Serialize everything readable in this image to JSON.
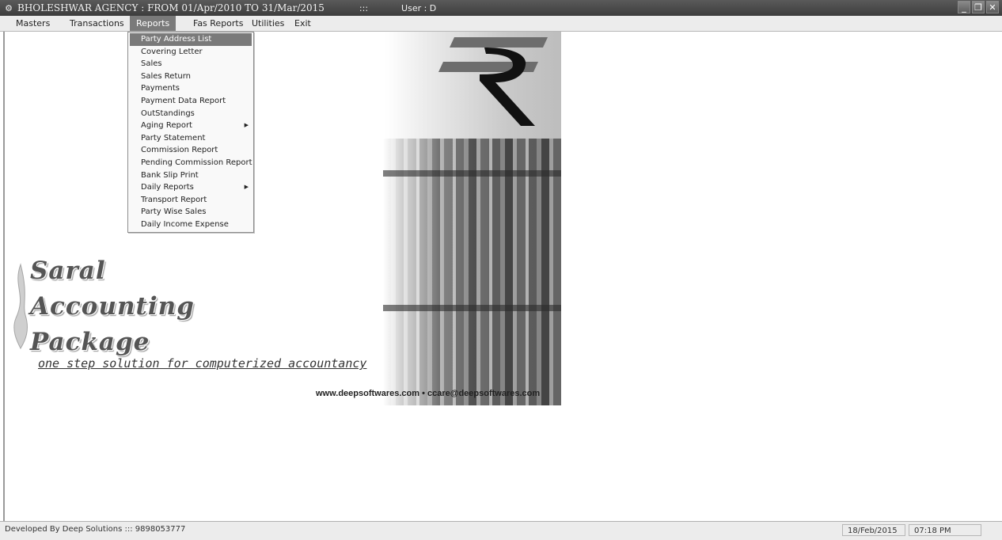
{
  "window": {
    "icon": "app-icon",
    "title": "BHOLESHWAR AGENCY : FROM 01/Apr/2010 TO 31/Mar/2015",
    "separator": ":::",
    "user": "User : D",
    "buttons": {
      "minimize": "_",
      "restore": "❐",
      "close": "✕"
    }
  },
  "menubar": {
    "items": [
      {
        "label": "Masters"
      },
      {
        "label": "Transactions"
      },
      {
        "label": "Reports"
      },
      {
        "label": "Fas Reports"
      },
      {
        "label": "Utilities"
      },
      {
        "label": "Exit"
      }
    ]
  },
  "reports_menu": {
    "items": [
      {
        "label": "Party Address List",
        "selected": true
      },
      {
        "label": "Covering Letter"
      },
      {
        "label": "Sales"
      },
      {
        "label": "Sales Return"
      },
      {
        "label": "Payments"
      },
      {
        "label": "Payment Data Report"
      },
      {
        "label": "OutStandings"
      },
      {
        "label": "Aging Report",
        "submenu": true
      },
      {
        "label": "Party Statement"
      },
      {
        "label": "Commission Report"
      },
      {
        "label": "Pending Commission Report"
      },
      {
        "label": "Bank Slip Print"
      },
      {
        "label": "Daily Reports",
        "submenu": true
      },
      {
        "label": "Transport Report"
      },
      {
        "label": "Party Wise Sales"
      },
      {
        "label": "Daily Income Expense"
      }
    ],
    "submenu_arrow": "▶"
  },
  "splash": {
    "brand_lines": [
      "Saral",
      "Accounting",
      "Package"
    ],
    "tagline": "one step solution for computerized accountancy",
    "contact": "www.deepsoftwares.com • ccare@deepsoftwares.com"
  },
  "statusbar": {
    "developer": "Developed By Deep Solutions   :::   9898053777",
    "date": "18/Feb/2015",
    "time": "07:18 PM"
  }
}
